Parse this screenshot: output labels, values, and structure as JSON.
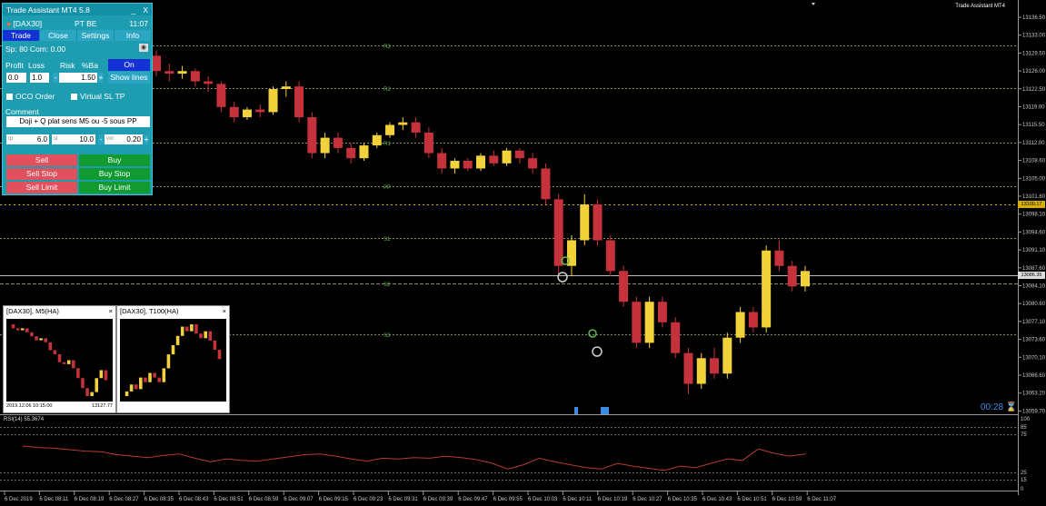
{
  "indicator_name": "Trade Assistant MT4",
  "timer": "00:28",
  "current_price": "13100.17",
  "bid_price": "13086.35",
  "rsi_label": "RSI(14) 55.3674",
  "panel": {
    "title": "Trade Assistant MT4 5.8",
    "min": "_",
    "close": "X",
    "symbol": "[DAX30]",
    "mode": "PT BE",
    "time": "11:07",
    "tabs": [
      "Trade",
      "Close",
      "Settings",
      "Info"
    ],
    "spread": "Sp: 80  Com: 0.00",
    "profit_label": "Profit",
    "loss_label": "Loss",
    "risk_label": "Risk",
    "pctba_label": "%Ba",
    "on_label": "On",
    "profit_value": "0.0",
    "loss_value": "1.0",
    "risk_value": "1.50",
    "show_lines": "Show lines",
    "oco_label": "OCO Order",
    "vsl_label": "Virtual SL TP",
    "comment_label": "Comment",
    "comment_value": "Doji + Q plat sens M5 ou -5 sous PP",
    "tp_label": "tp",
    "tp_value": "6.0",
    "sl_label": "sl",
    "sl_value": "10.0",
    "vol_label": "vol",
    "vol_value": "0.20",
    "sell": "Sell",
    "buy": "Buy",
    "sell_stop": "Sell Stop",
    "buy_stop": "Buy Stop",
    "sell_limit": "Sell Limit",
    "buy_limit": "Buy Limit"
  },
  "mini_charts": [
    {
      "title": "[DAX30], M5(HA)",
      "footer_left": "2019.12.06 10:15:00",
      "footer_right": "13127.77"
    },
    {
      "title": "[DAX30], T100(HA)",
      "footer_left": "",
      "footer_right": ""
    }
  ],
  "chart_data": {
    "type": "candlestick",
    "symbol": "DAX30",
    "price_axis": [
      "13136.50",
      "13133.00",
      "13129.50",
      "13126.00",
      "13122.50",
      "13119.00",
      "13115.50",
      "13112.00",
      "13108.60",
      "13105.00",
      "13101.60",
      "13098.10",
      "13094.60",
      "13091.10",
      "13087.60",
      "13084.10",
      "13080.60",
      "13077.10",
      "13073.60",
      "13070.10",
      "13066.60",
      "13063.20",
      "13059.70"
    ],
    "time_axis": [
      "6 Dec 2019",
      "6 Dec 08:11",
      "6 Dec 08:19",
      "6 Dec 08:27",
      "6 Dec 08:35",
      "6 Dec 08:43",
      "6 Dec 08:51",
      "6 Dec 08:59",
      "6 Dec 09:07",
      "6 Dec 09:15",
      "6 Dec 09:23",
      "6 Dec 09:31",
      "6 Dec 09:39",
      "6 Dec 09:47",
      "6 Dec 09:55",
      "6 Dec 10:03",
      "6 Dec 10:11",
      "6 Dec 10:19",
      "6 Dec 10:27",
      "6 Dec 10:35",
      "6 Dec 10:43",
      "6 Dec 10:51",
      "6 Dec 10:59",
      "6 Dec 11:07"
    ],
    "rsi_axis": [
      "100",
      "85",
      "75",
      "25",
      "15",
      "0"
    ],
    "pivot_labels": [
      "R3",
      "R2",
      "R1",
      "PP",
      "S1",
      "S2",
      "S3"
    ],
    "ylim": [
      13059.7,
      13136.5
    ],
    "candles": [
      [
        13129,
        13130,
        13125,
        13126
      ],
      [
        13126,
        13127.5,
        13124,
        13125.5
      ],
      [
        13125.5,
        13127,
        13124.5,
        13126
      ],
      [
        13126,
        13126.5,
        13123,
        13124
      ],
      [
        13124,
        13125,
        13122,
        13123.5
      ],
      [
        13123.5,
        13124,
        13118,
        13119
      ],
      [
        13119,
        13120,
        13116,
        13117
      ],
      [
        13117,
        13119,
        13116.5,
        13118.5
      ],
      [
        13118.5,
        13119.5,
        13117,
        13118
      ],
      [
        13118,
        13123,
        13117.5,
        13122.5
      ],
      [
        13122.5,
        13124,
        13121,
        13123
      ],
      [
        13123,
        13124,
        13116,
        13117
      ],
      [
        13117,
        13118,
        13109,
        13110
      ],
      [
        13110,
        13114,
        13109,
        13113
      ],
      [
        13113,
        13114,
        13110,
        13111
      ],
      [
        13111,
        13112,
        13108,
        13109
      ],
      [
        13109,
        13112,
        13108.5,
        13111.5
      ],
      [
        13111.5,
        13114,
        13111,
        13113.5
      ],
      [
        13113.5,
        13116,
        13113,
        13115.5
      ],
      [
        13115.5,
        13117,
        13114.5,
        13116
      ],
      [
        13116,
        13117,
        13113,
        13114
      ],
      [
        13114,
        13115,
        13109,
        13110
      ],
      [
        13110,
        13111,
        13106,
        13107
      ],
      [
        13107,
        13109,
        13106,
        13108.5
      ],
      [
        13108.5,
        13109,
        13106.5,
        13107
      ],
      [
        13107,
        13110,
        13106.5,
        13109.5
      ],
      [
        13109.5,
        13110.5,
        13107.5,
        13108
      ],
      [
        13108,
        13111,
        13107.5,
        13110.5
      ],
      [
        13110.5,
        13111,
        13108,
        13109
      ],
      [
        13109,
        13110,
        13106,
        13107
      ],
      [
        13107,
        13108,
        13100,
        13101
      ],
      [
        13101,
        13102,
        13086,
        13088
      ],
      [
        13088,
        13094,
        13086,
        13093
      ],
      [
        13093,
        13102,
        13092,
        13100
      ],
      [
        13100,
        13101,
        13092,
        13093
      ],
      [
        13093,
        13094,
        13086,
        13087
      ],
      [
        13087,
        13088,
        13080,
        13081
      ],
      [
        13081,
        13082,
        13072,
        13073
      ],
      [
        13073,
        13082,
        13072,
        13081
      ],
      [
        13081,
        13082,
        13076,
        13077
      ],
      [
        13077,
        13078,
        13070,
        13071
      ],
      [
        13071,
        13072,
        13063,
        13065
      ],
      [
        13065,
        13071,
        13064,
        13070
      ],
      [
        13070,
        13072,
        13066,
        13067
      ],
      [
        13067,
        13075,
        13066,
        13074
      ],
      [
        13074,
        13080,
        13073,
        13079
      ],
      [
        13079,
        13080,
        13075,
        13076
      ],
      [
        13076,
        13092,
        13075,
        13091
      ],
      [
        13091,
        13093,
        13087,
        13088
      ],
      [
        13088,
        13089,
        13083,
        13084
      ],
      [
        13084,
        13088,
        13083,
        13087
      ]
    ],
    "rsi": [
      62,
      60,
      59,
      57,
      55,
      54,
      50,
      48,
      46,
      49,
      51,
      45,
      40,
      44,
      42,
      41,
      44,
      47,
      50,
      51,
      48,
      44,
      41,
      45,
      44,
      46,
      45,
      48,
      46,
      43,
      38,
      30,
      36,
      45,
      40,
      36,
      32,
      30,
      38,
      34,
      31,
      28,
      34,
      32,
      38,
      44,
      42,
      58,
      52,
      48,
      51
    ]
  }
}
